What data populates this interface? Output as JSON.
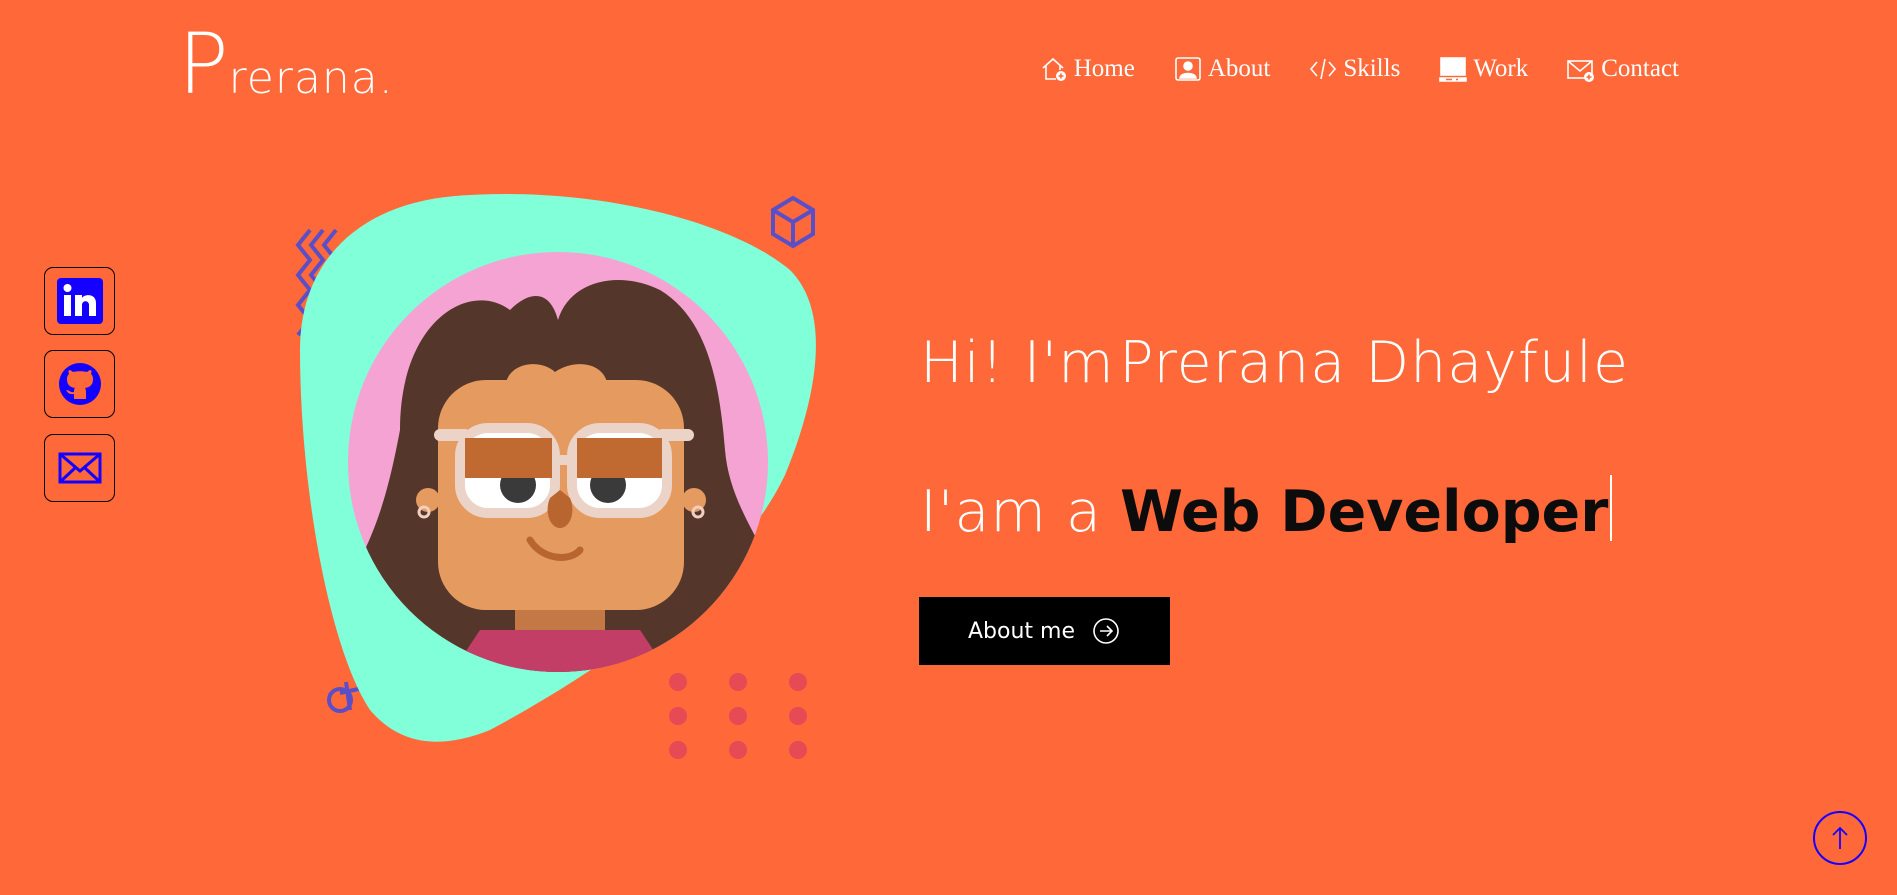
{
  "logo": {
    "initial": "P",
    "rest": "rerana."
  },
  "nav": [
    {
      "label": "Home",
      "icon": "home-icon"
    },
    {
      "label": "About",
      "icon": "user-icon"
    },
    {
      "label": "Skills",
      "icon": "code-icon"
    },
    {
      "label": "Work",
      "icon": "laptop-icon"
    },
    {
      "label": "Contact",
      "icon": "mail-icon"
    }
  ],
  "social": [
    {
      "name": "linkedin",
      "icon": "linkedin-icon"
    },
    {
      "name": "github",
      "icon": "github-icon"
    },
    {
      "name": "email",
      "icon": "mail-icon"
    }
  ],
  "hero": {
    "greeting_prefix": "Hi! I'm",
    "name": "Prerana Dhayfule",
    "role_prefix": "I'am a",
    "role": "Web Developer"
  },
  "button": {
    "label": "About me",
    "icon": "arrow-right-circle-icon"
  },
  "scroll_top": {
    "icon": "arrow-up-icon"
  },
  "colors": {
    "background": "#FF6838",
    "name_accent": "#2E2F66",
    "blob": "#80FFD8",
    "circle_pink": "#F5A3D3",
    "social_icons": "#1400FF",
    "button_bg": "#000000"
  }
}
